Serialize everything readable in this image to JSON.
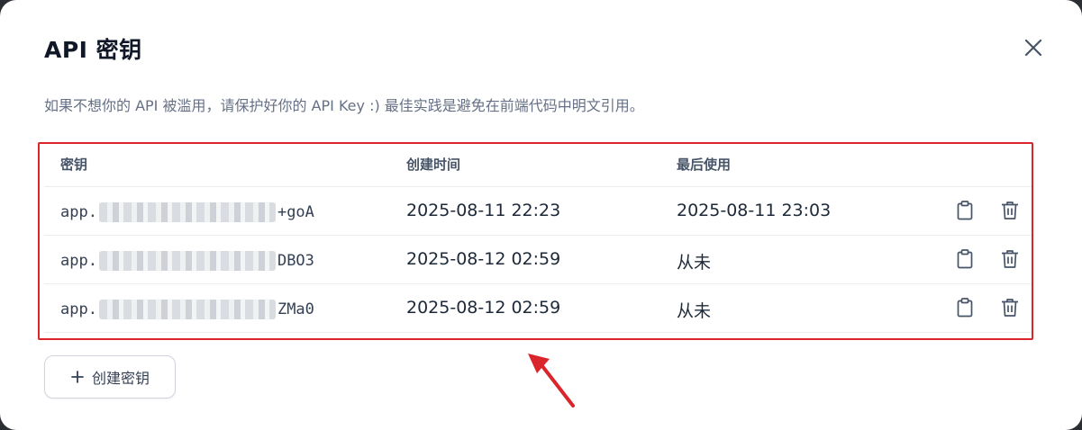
{
  "modal": {
    "title": "API 密钥",
    "description": "如果不想你的 API 被滥用，请保护好你的 API Key :) 最佳实践是避免在前端代码中明文引用。"
  },
  "table": {
    "headers": {
      "key": "密钥",
      "created": "创建时间",
      "last_used": "最后使用"
    },
    "rows": [
      {
        "key_prefix": "app.",
        "key_suffix": "+goA",
        "created": "2025-08-11 22:23",
        "last_used": "2025-08-11 23:03"
      },
      {
        "key_prefix": "app.",
        "key_suffix": "DBO3",
        "created": "2025-08-12 02:59",
        "last_used": "从未"
      },
      {
        "key_prefix": "app.",
        "key_suffix": "ZMa0",
        "created": "2025-08-12 02:59",
        "last_used": "从未"
      }
    ]
  },
  "actions": {
    "create_label": "创建密钥"
  },
  "colors": {
    "highlight": "#d9252b",
    "text_primary": "#1d2939",
    "text_secondary": "#667085"
  },
  "icons": {
    "close": "close-icon",
    "copy": "clipboard-icon",
    "delete": "trash-icon",
    "add": "plus-icon",
    "pointer": "arrow-annotation"
  }
}
